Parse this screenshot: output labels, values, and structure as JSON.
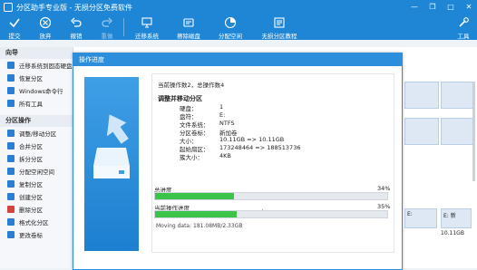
{
  "window": {
    "title": "分区助手专业版 - 无损分区免费软件",
    "controls": [
      "minimize",
      "restore",
      "maximize",
      "close"
    ]
  },
  "toolbar": {
    "items": [
      {
        "label": "提交",
        "icon": "check-icon",
        "enabled": true
      },
      {
        "label": "放弃",
        "icon": "discard-icon",
        "enabled": true
      },
      {
        "label": "撤销",
        "icon": "undo-icon",
        "enabled": true
      },
      {
        "label": "重做",
        "icon": "redo-icon",
        "enabled": false
      },
      {
        "label": "迁移系统",
        "icon": "migrate-system-icon",
        "enabled": true
      },
      {
        "label": "擦除磁盘",
        "icon": "wipe-disk-icon",
        "enabled": true
      },
      {
        "label": "分配空闲",
        "icon": "allocate-space-icon",
        "enabled": true
      },
      {
        "label": "无损分区教程",
        "icon": "tutorial-icon",
        "enabled": true
      },
      {
        "label": "工具",
        "icon": "tools-icon",
        "enabled": true
      }
    ]
  },
  "sidebar": {
    "wizard_header": "向导",
    "wizard_items": [
      {
        "label": "迁移系统到固态硬盘",
        "icon": "ssd-icon",
        "color": "#2a7fd4"
      },
      {
        "label": "恢复分区",
        "icon": "restore-icon",
        "color": "#2a7fd4"
      },
      {
        "label": "Windows命令行",
        "icon": "cmd-icon",
        "color": "#2a7fd4"
      },
      {
        "label": "所有工具",
        "icon": "tools-grid-icon",
        "color": "#2a7fd4"
      }
    ],
    "ops_header": "分区操作",
    "ops_items": [
      {
        "label": "调整/移动分区",
        "icon": "resize-icon",
        "color": "#2a7fd4"
      },
      {
        "label": "合并分区",
        "icon": "merge-icon",
        "color": "#2a7fd4"
      },
      {
        "label": "拆分分区",
        "icon": "split-icon",
        "color": "#2a7fd4"
      },
      {
        "label": "分配空闲空间",
        "icon": "allocate-icon",
        "color": "#2a7fd4"
      },
      {
        "label": "复制分区",
        "icon": "copy-icon",
        "color": "#2a7fd4"
      },
      {
        "label": "创建分区",
        "icon": "create-icon",
        "color": "#2a7fd4"
      },
      {
        "label": "删除分区",
        "icon": "delete-icon",
        "color": "#d64242"
      },
      {
        "label": "格式化分区",
        "icon": "format-icon",
        "color": "#2a7fd4"
      },
      {
        "label": "更改卷标",
        "icon": "label-icon",
        "color": "#2a7fd4"
      }
    ]
  },
  "disk_strip": {
    "cells": [
      {
        "text": ""
      },
      {
        "text": ""
      },
      {
        "text": ""
      },
      {
        "text": ""
      },
      {
        "text": "E:"
      },
      {
        "text": "E: 新"
      },
      {
        "text": "10.11GB"
      }
    ]
  },
  "dialog": {
    "title": "操作进度",
    "op_count": "当前操作数2，总操作数4",
    "op_title": "调整并移动分区",
    "fields": [
      {
        "key": "硬盘：",
        "value": "1"
      },
      {
        "key": "盘符：",
        "value": "E:"
      },
      {
        "key": "文件系统：",
        "value": "NTFS"
      },
      {
        "key": "分区卷标：",
        "value": "新加卷"
      },
      {
        "key": "大小：",
        "value": "10.11GB => 10.11GB"
      },
      {
        "key": "起始扇区：",
        "value": "173248464 => 188513736"
      },
      {
        "key": "簇大小：",
        "value": "4KB"
      }
    ],
    "total_progress": {
      "label": "总进度",
      "percent_text": "34%",
      "value": 0.34
    },
    "current_progress": {
      "label": "当前操作进度",
      "dot": "．",
      "percent_text": "35%",
      "value": 0.35
    },
    "moving_data": "Moving data: 181.08MB/2.33GB"
  }
}
